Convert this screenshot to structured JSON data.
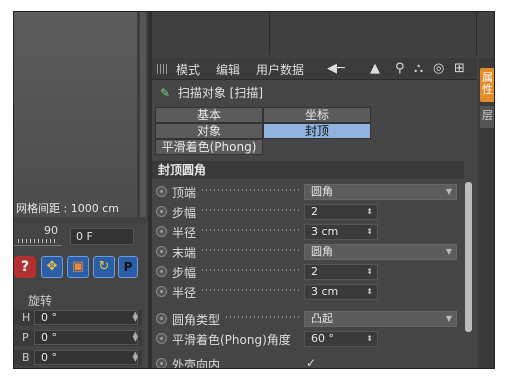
{
  "viewport": {
    "grid_spacing": "网格间距 : 1000 cm"
  },
  "timeline": {
    "ruler_value": "90",
    "frame_value": "0 F"
  },
  "tools": {
    "help": "?",
    "move": "✥",
    "scale": "▣",
    "rotate": "↻",
    "p": "P"
  },
  "left_section": {
    "label": "旋转"
  },
  "coords": [
    {
      "axis": "H",
      "value": "0 °"
    },
    {
      "axis": "P",
      "value": "0 °"
    },
    {
      "axis": "B",
      "value": "0 °"
    }
  ],
  "attributes": {
    "menu": [
      "模式",
      "编辑",
      "用户数据"
    ],
    "object_title": "扫描对象 [扫描]",
    "tabs": [
      {
        "label": "基本",
        "active": false
      },
      {
        "label": "坐标",
        "active": false
      },
      {
        "label": "对象",
        "active": false
      },
      {
        "label": "封顶",
        "active": true
      },
      {
        "label": "平滑着色(Phong)",
        "active": false
      }
    ],
    "section_title": "封顶圆角",
    "rows": [
      {
        "label": "顶端",
        "value": "圆角",
        "kind": "dropdown"
      },
      {
        "label": "步幅",
        "value": "2",
        "kind": "number"
      },
      {
        "label": "半径",
        "value": "3 cm",
        "kind": "number"
      },
      {
        "label": "末端",
        "value": "圆角",
        "kind": "dropdown"
      },
      {
        "label": "步幅",
        "value": "2",
        "kind": "number"
      },
      {
        "label": "半径",
        "value": "3 cm",
        "kind": "number"
      },
      {
        "label": "圆角类型",
        "value": "凸起",
        "kind": "dropdown"
      },
      {
        "label": "平滑着色(Phong)角度",
        "value": "60 °",
        "kind": "number"
      },
      {
        "label": "外壳向内",
        "value": "✓",
        "kind": "check"
      }
    ]
  },
  "side_tabs": [
    "属性",
    "层"
  ],
  "colors": {
    "active_tab": "#8fb3de",
    "side_tab_active": "#e48c2a",
    "panel_bg": "#454545"
  }
}
